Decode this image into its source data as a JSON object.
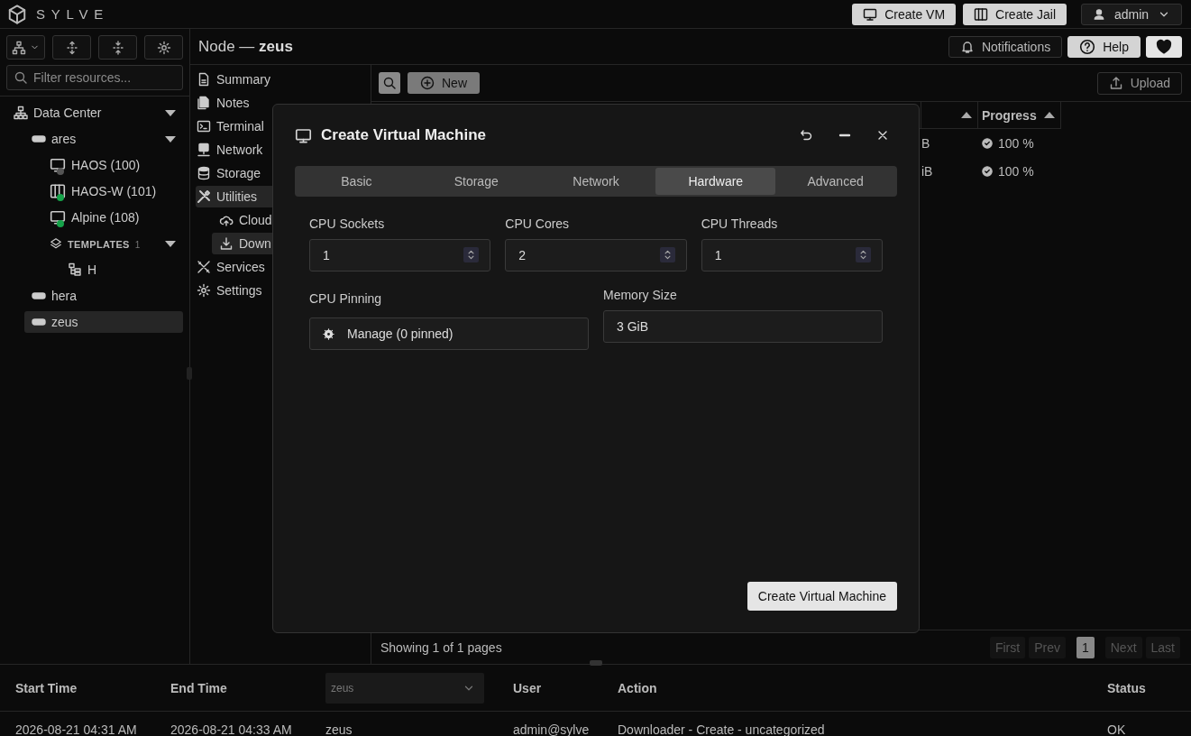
{
  "header": {
    "logo_text": "SYLVE",
    "buttons": [
      {
        "kind": "vm",
        "label": "Create VM"
      },
      {
        "kind": "jail",
        "label": "Create Jail"
      }
    ],
    "user": "admin"
  },
  "sidebar": {
    "filter_placeholder": "Filter resources...",
    "tree": [
      {
        "kind": "datacenter",
        "label": "Data Center",
        "expanded": true,
        "selected": false,
        "children": [
          {
            "kind": "node",
            "label": "ares",
            "expanded": true,
            "selected": false,
            "children": [
              {
                "kind": "vm",
                "label": "HAOS (100)",
                "color": "#555555",
                "selected": false
              },
              {
                "kind": "jail",
                "label": "HAOS-W (101)",
                "color": "#16a34a",
                "selected": false
              },
              {
                "kind": "vm",
                "label": "Alpine (108)",
                "color": "#16a34a",
                "selected": false
              },
              {
                "kind": "templates",
                "label": "TEMPLATES",
                "count": "1",
                "expanded": true,
                "selected": false,
                "children": [
                  {
                    "kind": "template",
                    "label": "H",
                    "selected": false
                  }
                ]
              }
            ]
          },
          {
            "kind": "node",
            "label": "hera",
            "selected": false
          },
          {
            "kind": "node",
            "label": "zeus",
            "selected": true
          }
        ]
      }
    ]
  },
  "node": {
    "title_prefix": "Node —",
    "title_name": "zeus",
    "buttons": [
      {
        "kind": "bell",
        "label": "Notifications"
      },
      {
        "kind": "help",
        "label": "Help"
      },
      {
        "kind": "heart"
      }
    ]
  },
  "node_menu": [
    {
      "label": "Summary",
      "selected": false
    },
    {
      "label": "Notes",
      "selected": false
    },
    {
      "label": "Terminal",
      "selected": false
    },
    {
      "label": "Network",
      "selected": false
    },
    {
      "label": "Storage",
      "selected": false
    },
    {
      "label": "Utilities",
      "selected": true,
      "children": [
        {
          "label": "Cloud",
          "selected": false
        },
        {
          "label": "Down",
          "selected": true
        }
      ]
    },
    {
      "label": "Services",
      "selected": false
    },
    {
      "label": "Settings",
      "selected": false
    }
  ],
  "toolbar": {
    "new_label": "New",
    "upload_label": "Upload"
  },
  "table": {
    "columns": [
      "Progress"
    ],
    "rows": [
      {
        "column_2": "B",
        "progress": "100 %"
      },
      {
        "column_2": "iB",
        "progress": "100 %"
      }
    ]
  },
  "table_footer": {
    "summary": "Showing 1 of 1 pages",
    "pagination": [
      {
        "label": "First",
        "selected": false,
        "disabled": true
      },
      {
        "label": "Prev",
        "selected": false,
        "disabled": true
      },
      {
        "label": "1",
        "selected": true,
        "disabled": false
      },
      {
        "label": "Next",
        "selected": false,
        "disabled": true
      },
      {
        "label": "Last",
        "selected": false,
        "disabled": true
      }
    ]
  },
  "modal": {
    "title": "Create Virtual Machine",
    "tabs": [
      {
        "label": "Basic",
        "selected": false
      },
      {
        "label": "Storage",
        "selected": false
      },
      {
        "label": "Network",
        "selected": false
      },
      {
        "label": "Hardware",
        "selected": true
      },
      {
        "label": "Advanced",
        "selected": false
      }
    ],
    "fields": [
      {
        "kind": "number",
        "label": "CPU Sockets",
        "value": "1"
      },
      {
        "kind": "number",
        "label": "CPU Cores",
        "value": "2"
      },
      {
        "kind": "number",
        "label": "CPU Threads",
        "value": "1"
      },
      {
        "kind": "button",
        "label": "CPU Pinning",
        "value": "Manage (0 pinned)"
      },
      {
        "kind": "text",
        "label": "Memory Size",
        "value": "3 GiB"
      }
    ],
    "submit_label": "Create Virtual Machine"
  },
  "log_panel": {
    "columns": [
      {
        "kind": "text",
        "label": "Start Time"
      },
      {
        "kind": "text",
        "label": "End Time"
      },
      {
        "kind": "select",
        "value": "zeus"
      },
      {
        "kind": "text",
        "label": "User"
      },
      {
        "kind": "text",
        "label": "Action"
      },
      {
        "kind": "text",
        "label": "Status"
      }
    ],
    "rows": [
      [
        "2026-08-21 04:31 AM",
        "2026-08-21 04:33 AM",
        "zeus",
        "admin@sylve",
        "Downloader - Create - uncategorized",
        "OK"
      ]
    ]
  }
}
